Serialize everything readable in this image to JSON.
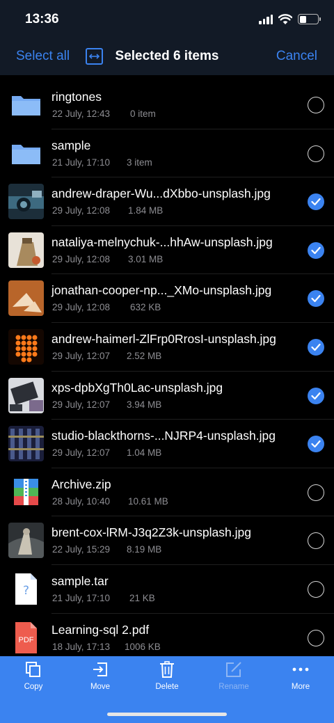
{
  "status": {
    "time": "13:36"
  },
  "nav": {
    "select_all": "Select all",
    "title": "Selected 6 items",
    "cancel": "Cancel"
  },
  "files": [
    {
      "name": "ringtones",
      "date": "22 July, 12:43",
      "size": "0 item",
      "kind": "folder",
      "selected": false
    },
    {
      "name": "sample",
      "date": "21 July, 17:10",
      "size": "3 item",
      "kind": "folder",
      "selected": false
    },
    {
      "name": "andrew-draper-Wu...dXbbo-unsplash.jpg",
      "date": "29 July, 12:08",
      "size": "1.84 MB",
      "kind": "image",
      "selected": true
    },
    {
      "name": "nataliya-melnychuk-...hhAw-unsplash.jpg",
      "date": "29 July, 12:08",
      "size": "3.01 MB",
      "kind": "image",
      "selected": true
    },
    {
      "name": "jonathan-cooper-np..._XMo-unsplash.jpg",
      "date": "29 July, 12:08",
      "size": "632 KB",
      "kind": "image",
      "selected": true
    },
    {
      "name": "andrew-haimerl-ZlFrp0RrosI-unsplash.jpg",
      "date": "29 July, 12:07",
      "size": "2.52 MB",
      "kind": "image",
      "selected": true
    },
    {
      "name": "xps-dpbXgTh0Lac-unsplash.jpg",
      "date": "29 July, 12:07",
      "size": "3.94 MB",
      "kind": "image",
      "selected": true
    },
    {
      "name": "studio-blackthorns-...NJRP4-unsplash.jpg",
      "date": "29 July, 12:07",
      "size": "1.04 MB",
      "kind": "image",
      "selected": true
    },
    {
      "name": "Archive.zip",
      "date": "28 July, 10:40",
      "size": "10.61 MB",
      "kind": "zip",
      "selected": false
    },
    {
      "name": "brent-cox-lRM-J3q2Z3k-unsplash.jpg",
      "date": "22 July, 15:29",
      "size": "8.19 MB",
      "kind": "image",
      "selected": false
    },
    {
      "name": "sample.tar",
      "date": "21 July, 17:10",
      "size": "21 KB",
      "kind": "unknown",
      "selected": false
    },
    {
      "name": "Learning-sql 2.pdf",
      "date": "18 July, 17:13",
      "size": "1006 KB",
      "kind": "pdf",
      "selected": false
    }
  ],
  "toolbar": {
    "copy": "Copy",
    "move": "Move",
    "delete": "Delete",
    "rename": "Rename",
    "more": "More"
  },
  "icons": {
    "folder": "folder-icon",
    "zip": "zip-file-icon",
    "pdf": "pdf-file-icon",
    "unknown": "unknown-file-icon",
    "copy": "copy-icon",
    "move": "move-icon",
    "delete": "trash-icon",
    "rename": "edit-icon",
    "more": "more-dots-icon"
  },
  "thumb_labels": {
    "pdf": "PDF",
    "unknown": "?"
  },
  "colors": {
    "accent": "#3b83f0",
    "background": "#000000",
    "navbar": "#121a26",
    "secondary_text": "#8e8e93"
  }
}
